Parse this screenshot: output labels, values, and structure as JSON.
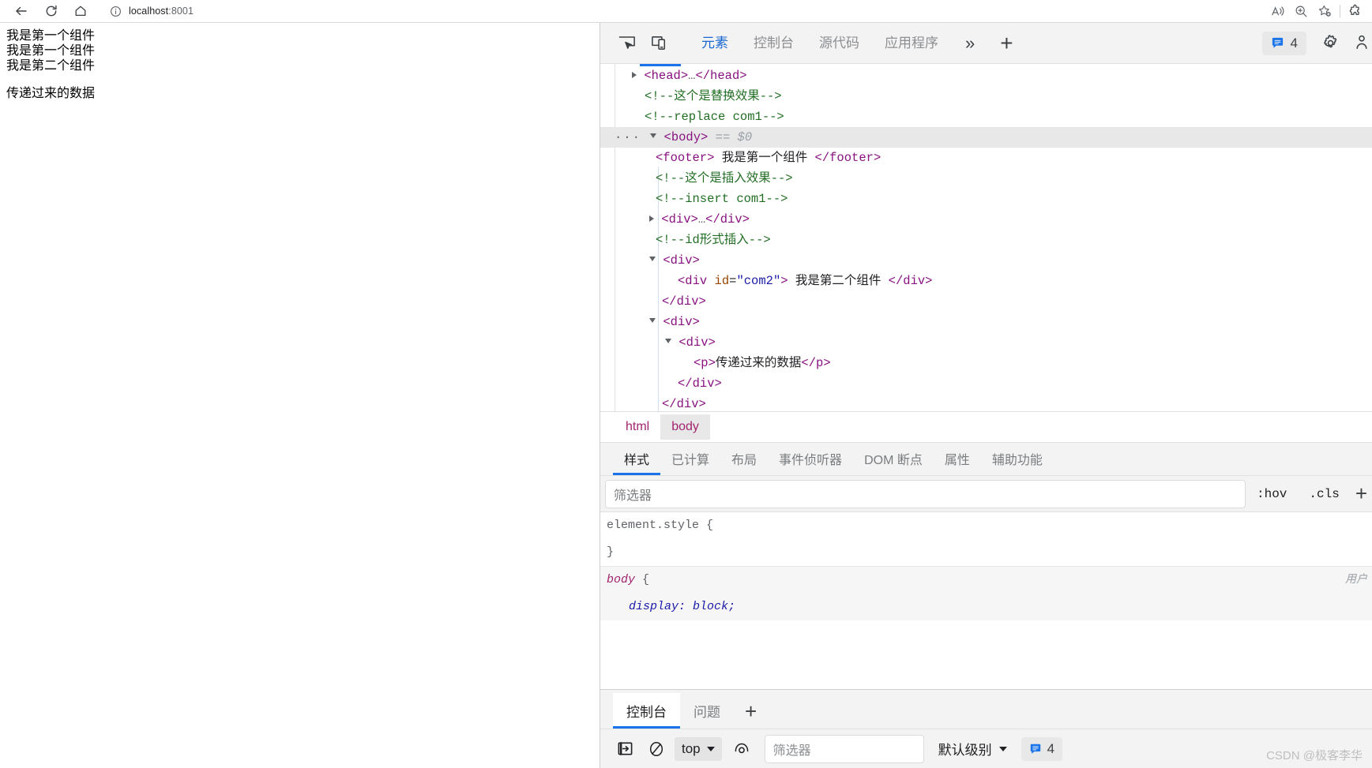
{
  "browser": {
    "url_prefix": "localhost",
    "url_suffix": ":8001",
    "url_full": "localhost:8001",
    "back_icon": "back-arrow-icon",
    "reload_icon": "reload-icon",
    "home_icon": "home-icon",
    "site_info_icon": "info-circle-icon",
    "right_icons": [
      "read-aloud-icon",
      "zoom-icon",
      "add-favorite-icon",
      "extensions-icon"
    ]
  },
  "page": {
    "lines": [
      "我是第一个组件",
      "我是第一个组件",
      "我是第二个组件"
    ],
    "paragraph": "传递过来的数据"
  },
  "devtools": {
    "inspect_icon": "inspect-element-icon",
    "device_icon": "device-toolbar-icon",
    "tabs": [
      {
        "label": "元素",
        "active": true
      },
      {
        "label": "控制台",
        "active": false
      },
      {
        "label": "源代码",
        "active": false
      },
      {
        "label": "应用程序",
        "active": false
      }
    ],
    "more_tabs_label": "»",
    "add_tab_label": "+",
    "issues_count": "4",
    "issues_icon": "issues-bubble-icon",
    "settings_icon": "gear-icon",
    "more_options_icon": "more-options-icon",
    "dom_rows": [
      {
        "indent": 22,
        "marker": "triangle-right",
        "dots": false,
        "selected": false,
        "parts": [
          {
            "t": "tag",
            "v": "<head>"
          },
          {
            "t": "ellipsis",
            "v": "…"
          },
          {
            "t": "tag",
            "v": "</head>"
          }
        ]
      },
      {
        "indent": 38,
        "marker": "none",
        "dots": false,
        "selected": false,
        "parts": [
          {
            "t": "comment",
            "v": "<!--这个是替换效果-->"
          }
        ]
      },
      {
        "indent": 38,
        "marker": "none",
        "dots": false,
        "selected": false,
        "parts": [
          {
            "t": "comment",
            "v": "<!--replace com1-->"
          }
        ]
      },
      {
        "indent": 22,
        "marker": "triangle-down",
        "dots": true,
        "selected": true,
        "parts": [
          {
            "t": "tag",
            "v": "<body>"
          },
          {
            "t": "dollar",
            "v": "  ==  $0"
          }
        ]
      },
      {
        "indent": 52,
        "marker": "none",
        "dots": false,
        "selected": false,
        "parts": [
          {
            "t": "tag",
            "v": "<footer>"
          },
          {
            "t": "text",
            "v": " 我是第一个组件 "
          },
          {
            "t": "tag",
            "v": "</footer>"
          }
        ]
      },
      {
        "indent": 52,
        "marker": "none",
        "dots": false,
        "selected": false,
        "parts": [
          {
            "t": "comment",
            "v": "<!--这个是插入效果-->"
          }
        ]
      },
      {
        "indent": 52,
        "marker": "none",
        "dots": false,
        "selected": false,
        "parts": [
          {
            "t": "comment",
            "v": "<!--insert com1-->"
          }
        ]
      },
      {
        "indent": 44,
        "marker": "triangle-right",
        "dots": false,
        "selected": false,
        "parts": [
          {
            "t": "tag",
            "v": "<div>"
          },
          {
            "t": "ellipsis",
            "v": "…"
          },
          {
            "t": "tag",
            "v": "</div>"
          }
        ]
      },
      {
        "indent": 52,
        "marker": "none",
        "dots": false,
        "selected": false,
        "parts": [
          {
            "t": "comment",
            "v": "<!--id形式插入-->"
          }
        ]
      },
      {
        "indent": 44,
        "marker": "triangle-down",
        "dots": false,
        "selected": false,
        "parts": [
          {
            "t": "tag",
            "v": "<div>"
          }
        ]
      },
      {
        "indent": 80,
        "marker": "none",
        "dots": false,
        "selected": false,
        "parts": [
          {
            "t": "tagopen",
            "v": "<div"
          },
          {
            "t": "attrname",
            "v": " id"
          },
          {
            "t": "plain",
            "v": "="
          },
          {
            "t": "attrval",
            "v": "\"com2\""
          },
          {
            "t": "tagopen",
            "v": ">"
          },
          {
            "t": "text",
            "v": " 我是第二个组件 "
          },
          {
            "t": "tag",
            "v": "</div>"
          }
        ]
      },
      {
        "indent": 60,
        "marker": "none",
        "dots": false,
        "selected": false,
        "parts": [
          {
            "t": "tag",
            "v": "</div>"
          }
        ]
      },
      {
        "indent": 44,
        "marker": "triangle-down",
        "dots": false,
        "selected": false,
        "parts": [
          {
            "t": "tag",
            "v": "<div>"
          }
        ]
      },
      {
        "indent": 64,
        "marker": "triangle-down",
        "dots": false,
        "selected": false,
        "parts": [
          {
            "t": "tag",
            "v": "<div>"
          }
        ]
      },
      {
        "indent": 100,
        "marker": "none",
        "dots": false,
        "selected": false,
        "parts": [
          {
            "t": "tag",
            "v": "<p>"
          },
          {
            "t": "text",
            "v": "传递过来的数据"
          },
          {
            "t": "tag",
            "v": "</p>"
          }
        ]
      },
      {
        "indent": 80,
        "marker": "none",
        "dots": false,
        "selected": false,
        "parts": [
          {
            "t": "tag",
            "v": "</div>"
          }
        ]
      },
      {
        "indent": 60,
        "marker": "none",
        "dots": false,
        "selected": false,
        "parts": [
          {
            "t": "tag",
            "v": "</div>"
          }
        ]
      }
    ],
    "breadcrumb": [
      {
        "label": "html",
        "active": false
      },
      {
        "label": "body",
        "active": true
      }
    ],
    "styles_tabs": [
      {
        "label": "样式",
        "active": true
      },
      {
        "label": "已计算",
        "active": false
      },
      {
        "label": "布局",
        "active": false
      },
      {
        "label": "事件侦听器",
        "active": false
      },
      {
        "label": "DOM 断点",
        "active": false
      },
      {
        "label": "属性",
        "active": false
      },
      {
        "label": "辅助功能",
        "active": false
      }
    ],
    "styles_filter_placeholder": "筛选器",
    "hov_label": ":hov",
    "cls_label": ".cls",
    "add_rule_label": "+",
    "rules": [
      {
        "selector": "element.style",
        "open_brace": "{",
        "close_brace": "}",
        "declarations": [],
        "origin": "",
        "shaded": false
      },
      {
        "selector": "body",
        "open_brace": "{",
        "close_brace": "",
        "declarations": [
          "display: block;"
        ],
        "origin": "用户",
        "shaded": true
      }
    ],
    "drawer_tabs": [
      {
        "label": "控制台",
        "active": true
      },
      {
        "label": "问题",
        "active": false
      }
    ],
    "drawer_add_label": "+",
    "console_toolbar": {
      "sidebar_icon": "show-console-sidebar-icon",
      "clear_icon": "clear-console-icon",
      "context": "top",
      "eye_icon": "live-expression-icon",
      "filter_placeholder": "筛选器",
      "level": "默认级别",
      "issues_count": "4",
      "issues_icon": "issues-bubble-icon"
    }
  },
  "watermark": "CSDN @极客李华"
}
